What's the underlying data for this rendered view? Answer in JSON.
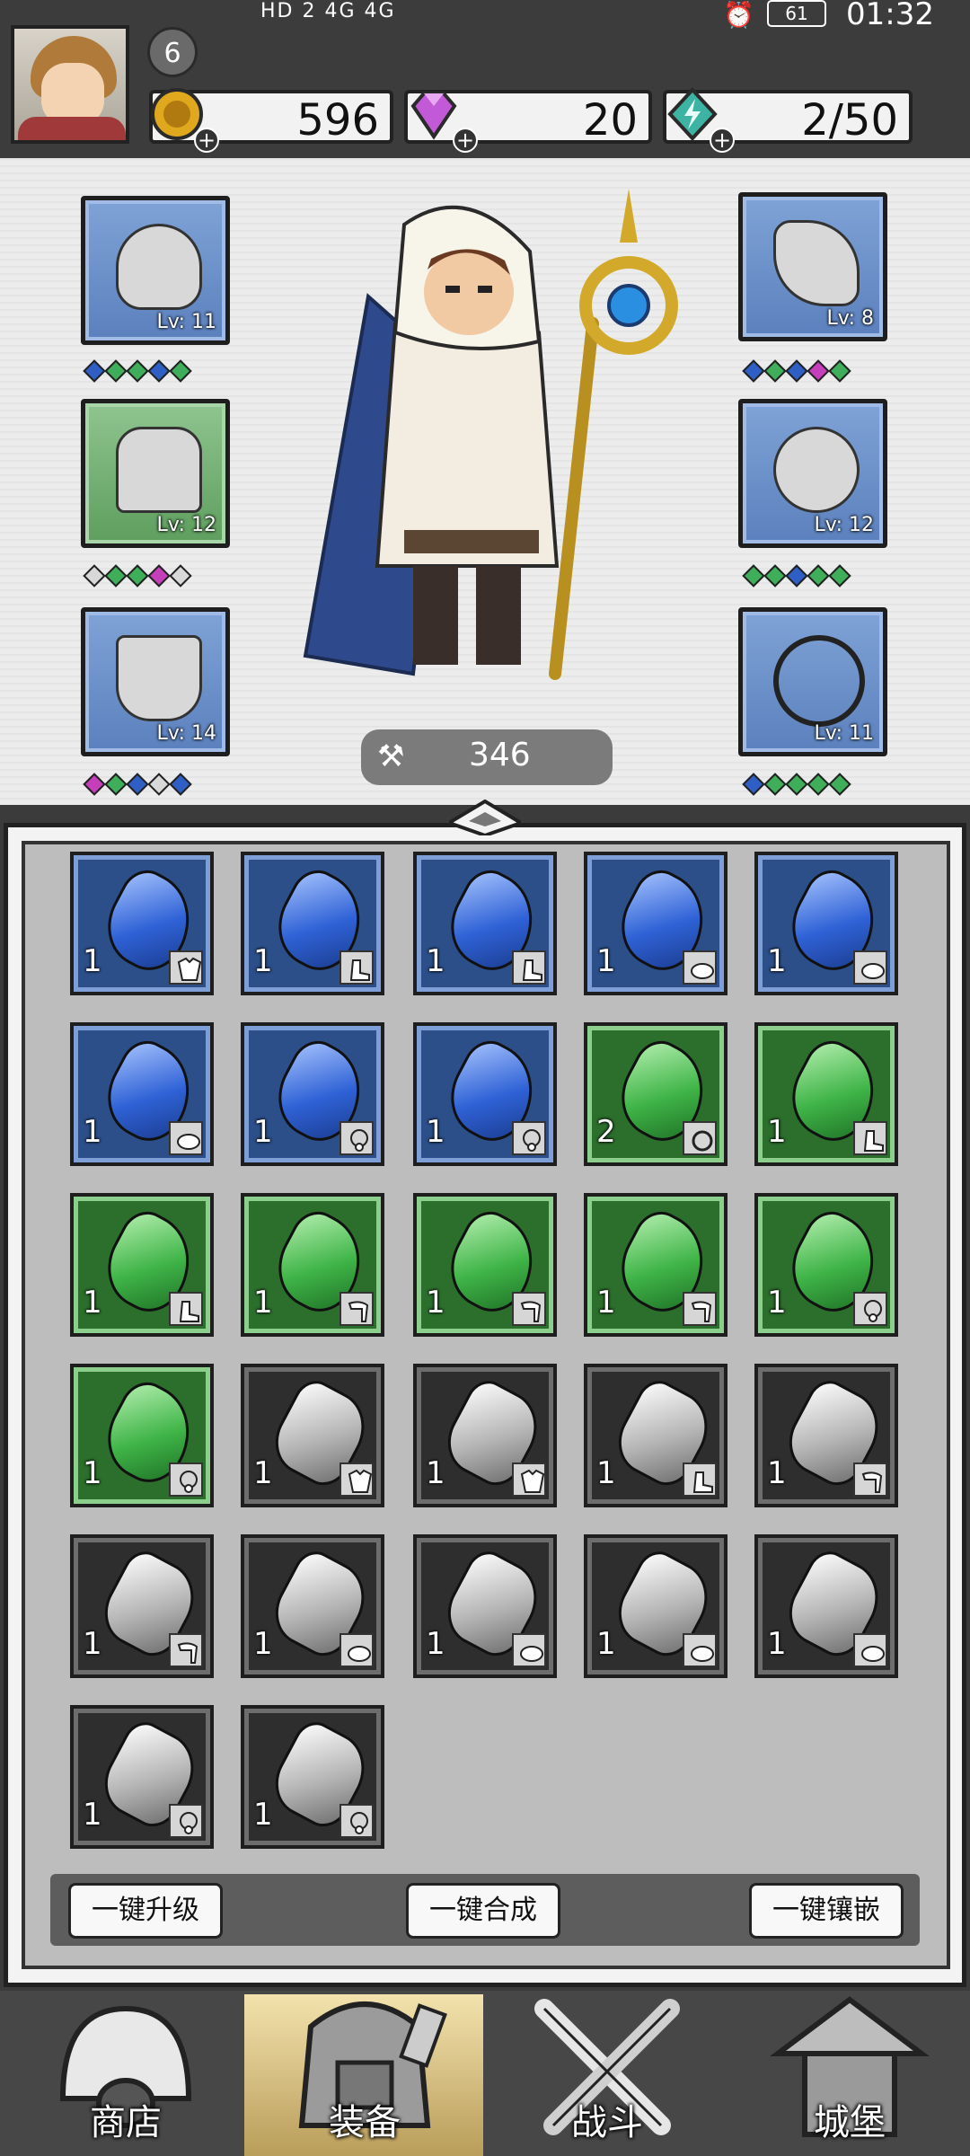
{
  "status_bar": {
    "signal_text": "HD 2  4G  4G",
    "battery": "61",
    "time": "01:32"
  },
  "player": {
    "level": "6"
  },
  "resources": {
    "gold": "596",
    "gems": "20",
    "energy": "2/50"
  },
  "equipment": {
    "left": [
      {
        "name": "helmet",
        "level": "Lv: 11",
        "rarity": "blue",
        "gems": [
          "b",
          "g",
          "g",
          "b",
          "g"
        ]
      },
      {
        "name": "armor",
        "level": "Lv: 12",
        "rarity": "green",
        "gems": [
          "w",
          "g",
          "g",
          "p",
          "w"
        ]
      },
      {
        "name": "boots",
        "level": "Lv: 14",
        "rarity": "blue",
        "gems": [
          "p",
          "g",
          "b",
          "w",
          "b"
        ]
      }
    ],
    "right": [
      {
        "name": "weapon",
        "level": "Lv: 8",
        "rarity": "blue",
        "gems": [
          "b",
          "g",
          "b",
          "p",
          "g"
        ]
      },
      {
        "name": "ring",
        "level": "Lv: 12",
        "rarity": "blue",
        "gems": [
          "g",
          "g",
          "b",
          "g",
          "g"
        ]
      },
      {
        "name": "necklace",
        "level": "Lv: 11",
        "rarity": "blue",
        "gems": [
          "b",
          "g",
          "g",
          "g",
          "g"
        ]
      }
    ]
  },
  "power": "346",
  "inventory": [
    {
      "rarity": "blue",
      "count": "1",
      "slot": "armor"
    },
    {
      "rarity": "blue",
      "count": "1",
      "slot": "boots"
    },
    {
      "rarity": "blue",
      "count": "1",
      "slot": "boots"
    },
    {
      "rarity": "blue",
      "count": "1",
      "slot": "helmet"
    },
    {
      "rarity": "blue",
      "count": "1",
      "slot": "helmet"
    },
    {
      "rarity": "blue",
      "count": "1",
      "slot": "helmet"
    },
    {
      "rarity": "blue",
      "count": "1",
      "slot": "necklace"
    },
    {
      "rarity": "blue",
      "count": "1",
      "slot": "necklace"
    },
    {
      "rarity": "green",
      "count": "2",
      "slot": "ring"
    },
    {
      "rarity": "green",
      "count": "1",
      "slot": "boots"
    },
    {
      "rarity": "green",
      "count": "1",
      "slot": "boots"
    },
    {
      "rarity": "green",
      "count": "1",
      "slot": "weapon"
    },
    {
      "rarity": "green",
      "count": "1",
      "slot": "weapon"
    },
    {
      "rarity": "green",
      "count": "1",
      "slot": "weapon"
    },
    {
      "rarity": "green",
      "count": "1",
      "slot": "necklace"
    },
    {
      "rarity": "green",
      "count": "1",
      "slot": "necklace"
    },
    {
      "rarity": "gray",
      "count": "1",
      "slot": "armor"
    },
    {
      "rarity": "gray",
      "count": "1",
      "slot": "armor"
    },
    {
      "rarity": "gray",
      "count": "1",
      "slot": "boots"
    },
    {
      "rarity": "gray",
      "count": "1",
      "slot": "weapon"
    },
    {
      "rarity": "gray",
      "count": "1",
      "slot": "weapon"
    },
    {
      "rarity": "gray",
      "count": "1",
      "slot": "helmet"
    },
    {
      "rarity": "gray",
      "count": "1",
      "slot": "helmet"
    },
    {
      "rarity": "gray",
      "count": "1",
      "slot": "helmet"
    },
    {
      "rarity": "gray",
      "count": "1",
      "slot": "helmet"
    },
    {
      "rarity": "gray",
      "count": "1",
      "slot": "necklace"
    },
    {
      "rarity": "gray",
      "count": "1",
      "slot": "necklace"
    }
  ],
  "actions": {
    "upgrade_all": "一键升级",
    "merge_all": "一键合成",
    "inlay_all": "一键镶嵌"
  },
  "nav": {
    "shop": "商店",
    "equipment": "装备",
    "battle": "战斗",
    "castle": "城堡"
  },
  "colors": {
    "blue_frame": "#7d9ed6",
    "green_frame": "#8ccf8c",
    "gray_frame": "#6d6d6d",
    "nav_active": "#d9c27f"
  }
}
